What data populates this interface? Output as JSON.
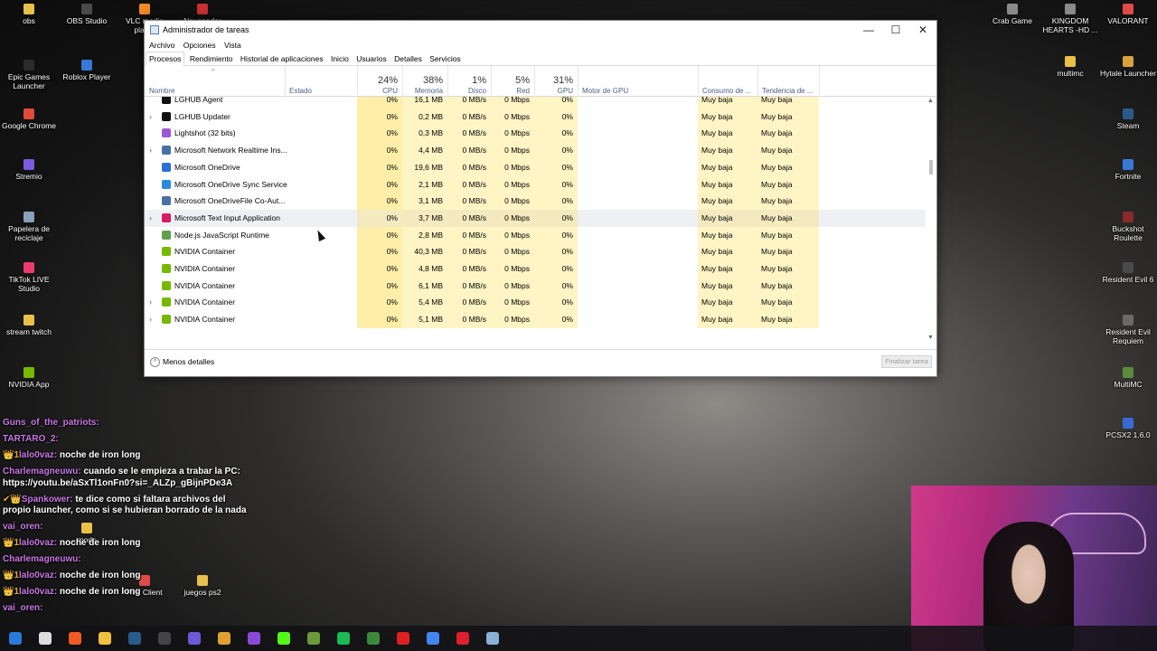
{
  "desktop": {
    "icons_left": [
      {
        "label": "obs",
        "color": "#e8c04a"
      },
      {
        "label": "OBS Studio",
        "color": "#4a4a4a"
      },
      {
        "label": "VLC media player",
        "color": "#f08a24"
      },
      {
        "label": "Navegador",
        "color": "#c8312e"
      },
      {
        "label": "Epic Games Launcher",
        "color": "#2b2b2b"
      },
      {
        "label": "Roblox Player",
        "color": "#3a78d8"
      },
      {
        "label": "Google Chrome",
        "color": "#e04a3a"
      },
      {
        "label": "Stremio",
        "color": "#7a5ae0"
      },
      {
        "label": "Papelera de reciclaje",
        "color": "#8aa0b8"
      },
      {
        "label": "TikTok LIVE Studio",
        "color": "#e83c6a"
      },
      {
        "label": "stream twitch",
        "color": "#e8c04a"
      },
      {
        "label": "NVIDIA App",
        "color": "#76b900"
      }
    ],
    "icons_right": [
      {
        "label": "Crab Game",
        "color": "#8a8a8a"
      },
      {
        "label": "KINGDOM HEARTS -HD ...",
        "color": "#8a8a8a"
      },
      {
        "label": "VALORANT",
        "color": "#e04a4a"
      },
      {
        "label": "multimc",
        "color": "#e8c04a"
      },
      {
        "label": "Hytale Launcher",
        "color": "#d8a040"
      },
      {
        "label": "Steam",
        "color": "#2a5a8a"
      },
      {
        "label": "Fortnite",
        "color": "#3a78d8"
      },
      {
        "label": "Buckshot Roulette",
        "color": "#8a2a2a"
      },
      {
        "label": "Resident Evil 6",
        "color": "#4a4a4a"
      },
      {
        "label": "Resident Evil Requiem",
        "color": "#6a6a6a"
      },
      {
        "label": "MultiMC",
        "color": "#5a8a3a"
      },
      {
        "label": "PCSX2 1.6.0",
        "color": "#3a6ad8"
      }
    ],
    "icons_bottom": [
      {
        "label": "mods",
        "color": "#e8c04a"
      },
      {
        "label": "Riot Client",
        "color": "#e04a4a"
      },
      {
        "label": "juegos ps2",
        "color": "#e8c04a"
      }
    ]
  },
  "window": {
    "title": "Administrador de tareas",
    "controls": {
      "minimize": "—",
      "maximize": "☐",
      "close": "✕"
    },
    "menu": [
      "Archivo",
      "Opciones",
      "Vista"
    ],
    "tabs": [
      "Procesos",
      "Rendimiento",
      "Historial de aplicaciones",
      "Inicio",
      "Usuarios",
      "Detalles",
      "Servicios"
    ],
    "active_tab": "Procesos",
    "columns": {
      "name": "Nombre",
      "status": "Estado",
      "cpu": {
        "pct": "24%",
        "label": "CPU"
      },
      "mem": {
        "pct": "38%",
        "label": "Memoria"
      },
      "disk": {
        "pct": "1%",
        "label": "Disco"
      },
      "net": {
        "pct": "5%",
        "label": "Red"
      },
      "gpu": {
        "pct": "31%",
        "label": "GPU"
      },
      "gpu_engine": "Motor de GPU",
      "power": "Consumo de ...",
      "power_trend": "Tendencia de ..."
    },
    "rows": [
      {
        "expand": false,
        "icon": "logitech-icon",
        "color": "#111111",
        "name": "LGHUB Agent",
        "cpu": "0%",
        "mem": "16,1 MB",
        "disk": "0 MB/s",
        "net": "0 Mbps",
        "gpu": "0%",
        "power": "Muy baja",
        "trend": "Muy baja"
      },
      {
        "expand": true,
        "icon": "logitech-icon",
        "color": "#111111",
        "name": "LGHUB Updater",
        "cpu": "0%",
        "mem": "0,2 MB",
        "disk": "0 MB/s",
        "net": "0 Mbps",
        "gpu": "0%",
        "power": "Muy baja",
        "trend": "Muy baja"
      },
      {
        "expand": false,
        "icon": "feather-icon",
        "color": "#9b59d6",
        "name": "Lightshot (32 bits)",
        "cpu": "0%",
        "mem": "0,3 MB",
        "disk": "0 MB/s",
        "net": "0 Mbps",
        "gpu": "0%",
        "power": "Muy baja",
        "trend": "Muy baja"
      },
      {
        "expand": true,
        "icon": "window-app-icon",
        "color": "#4a6fa5",
        "name": "Microsoft Network Realtime Ins...",
        "cpu": "0%",
        "mem": "4,4 MB",
        "disk": "0 MB/s",
        "net": "0 Mbps",
        "gpu": "0%",
        "power": "Muy baja",
        "trend": "Muy baja"
      },
      {
        "expand": false,
        "icon": "cloud-icon",
        "color": "#2a6ed8",
        "name": "Microsoft OneDrive",
        "cpu": "0%",
        "mem": "19,6 MB",
        "disk": "0 MB/s",
        "net": "0 Mbps",
        "gpu": "0%",
        "power": "Muy baja",
        "trend": "Muy baja"
      },
      {
        "expand": false,
        "icon": "cloud-icon",
        "color": "#2a8ae0",
        "name": "Microsoft OneDrive Sync Service",
        "cpu": "0%",
        "mem": "2,1 MB",
        "disk": "0 MB/s",
        "net": "0 Mbps",
        "gpu": "0%",
        "power": "Muy baja",
        "trend": "Muy baja"
      },
      {
        "expand": false,
        "icon": "window-app-icon",
        "color": "#4a6fa5",
        "name": "Microsoft OneDriveFile Co-Aut...",
        "cpu": "0%",
        "mem": "3,1 MB",
        "disk": "0 MB/s",
        "net": "0 Mbps",
        "gpu": "0%",
        "power": "Muy baja",
        "trend": "Muy baja"
      },
      {
        "expand": true,
        "icon": "text-input-icon",
        "color": "#d81b60",
        "name": "Microsoft Text Input Application",
        "cpu": "0%",
        "mem": "3,7 MB",
        "disk": "0 MB/s",
        "net": "0 Mbps",
        "gpu": "0%",
        "power": "Muy baja",
        "trend": "Muy baja",
        "hover": true
      },
      {
        "expand": false,
        "icon": "nodejs-icon",
        "color": "#5fa04e",
        "name": "Node.js JavaScript Runtime",
        "cpu": "0%",
        "mem": "2,8 MB",
        "disk": "0 MB/s",
        "net": "0 Mbps",
        "gpu": "0%",
        "power": "Muy baja",
        "trend": "Muy baja"
      },
      {
        "expand": false,
        "icon": "nvidia-icon",
        "color": "#76b900",
        "name": "NVIDIA Container",
        "cpu": "0%",
        "mem": "40,3 MB",
        "disk": "0 MB/s",
        "net": "0 Mbps",
        "gpu": "0%",
        "power": "Muy baja",
        "trend": "Muy baja"
      },
      {
        "expand": false,
        "icon": "nvidia-icon",
        "color": "#76b900",
        "name": "NVIDIA Container",
        "cpu": "0%",
        "mem": "4,8 MB",
        "disk": "0 MB/s",
        "net": "0 Mbps",
        "gpu": "0%",
        "power": "Muy baja",
        "trend": "Muy baja"
      },
      {
        "expand": false,
        "icon": "nvidia-icon",
        "color": "#76b900",
        "name": "NVIDIA Container",
        "cpu": "0%",
        "mem": "6,1 MB",
        "disk": "0 MB/s",
        "net": "0 Mbps",
        "gpu": "0%",
        "power": "Muy baja",
        "trend": "Muy baja"
      },
      {
        "expand": true,
        "icon": "nvidia-icon",
        "color": "#76b900",
        "name": "NVIDIA Container",
        "cpu": "0%",
        "mem": "5,4 MB",
        "disk": "0 MB/s",
        "net": "0 Mbps",
        "gpu": "0%",
        "power": "Muy baja",
        "trend": "Muy baja"
      },
      {
        "expand": true,
        "icon": "nvidia-icon",
        "color": "#76b900",
        "name": "NVIDIA Container",
        "cpu": "0%",
        "mem": "5,1 MB",
        "disk": "0 MB/s",
        "net": "0 Mbps",
        "gpu": "0%",
        "power": "Muy baja",
        "trend": "Muy baja"
      }
    ],
    "footer": {
      "less_details": "Menos detalles",
      "end_task": "Finalizar tarea"
    }
  },
  "chat": [
    {
      "user": "Guns_of_the_patriots:",
      "msg": "",
      "badge": ""
    },
    {
      "user": "TARTARO_2:",
      "msg": "",
      "badge": ""
    },
    {
      "user": "lalo0vaz:",
      "msg": "noche de iron long",
      "badge": "👑1"
    },
    {
      "user": "Charlemagneuwu:",
      "msg": "cuando se le empieza a trabar la PC: https://youtu.be/aSxTl1onFn0?si=_ALZp_gBijnPDe3A",
      "badge": ""
    },
    {
      "user": "Spankower:",
      "msg": "te dice como si faltara archivos del propio launcher, como si se hubieran borrado de la nada",
      "badge": "✔👑"
    },
    {
      "user": "vai_oren:",
      "msg": "",
      "badge": ""
    },
    {
      "user": "lalo0vaz:",
      "msg": "noche de iron long",
      "badge": "👑1"
    },
    {
      "user": "Charlemagneuwu:",
      "msg": "",
      "badge": ""
    },
    {
      "user": "lalo0vaz:",
      "msg": "noche de iron long",
      "badge": "👑1"
    },
    {
      "user": "lalo0vaz:",
      "msg": "noche de iron long",
      "badge": "👑1"
    },
    {
      "user": "vai_oren:",
      "msg": "",
      "badge": ""
    }
  ],
  "taskbar": {
    "icons": [
      {
        "name": "windows-start-icon",
        "color": "#2a7ad8"
      },
      {
        "name": "search-icon",
        "color": "#dddddd"
      },
      {
        "name": "brave-icon",
        "color": "#f05a24"
      },
      {
        "name": "file-explorer-icon",
        "color": "#f0c040"
      },
      {
        "name": "steam-icon",
        "color": "#2a5a8a"
      },
      {
        "name": "obs-icon",
        "color": "#444444"
      },
      {
        "name": "chrome-alt-icon",
        "color": "#6a5ad8"
      },
      {
        "name": "chrome-icon",
        "color": "#e0a030"
      },
      {
        "name": "app-c-icon",
        "color": "#8a4ad8"
      },
      {
        "name": "kick-icon",
        "color": "#53fc18"
      },
      {
        "name": "minecraft-icon",
        "color": "#6a9a3a"
      },
      {
        "name": "spotify-icon",
        "color": "#1db954"
      },
      {
        "name": "app-green-icon",
        "color": "#3a8a3a"
      },
      {
        "name": "youtube-studio-icon",
        "color": "#e02020"
      },
      {
        "name": "chrome-icon-2",
        "color": "#4285f4"
      },
      {
        "name": "opera-icon",
        "color": "#e01e2e"
      },
      {
        "name": "task-manager-icon",
        "color": "#8ab0d8"
      }
    ]
  }
}
